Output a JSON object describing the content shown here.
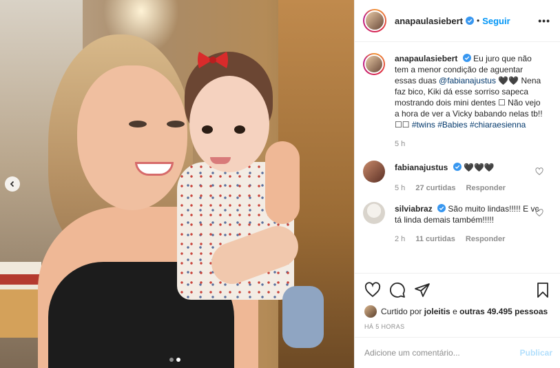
{
  "post": {
    "username": "anapaulasiebert",
    "separator": "•",
    "follow_label": "Seguir",
    "more_icon": "more-options-icon",
    "caption": {
      "username": "anapaulasiebert",
      "text_1": "Eu juro que não tem a menor condição de aguentar essas duas",
      "mention": "@fabianajustus",
      "text_2": "🖤🖤 Nena faz bico, Kiki dá esse sorriso sapeca mostrando dois mini dentes ☐ Não vejo a hora de ver a Vicky babando nelas tb!! ☐☐",
      "hashtag_1": "#twins",
      "hashtag_2": "#Babies",
      "hashtag_3": "#chiaraesienna",
      "time": "5 h"
    },
    "comments": [
      {
        "username": "fabianajustus",
        "text": "🖤🖤🖤",
        "time": "5 h",
        "likes": "27 curtidas",
        "reply": "Responder"
      },
      {
        "username": "silviabraz",
        "text": "São muito lindas!!!!! E vc tá linda demais também!!!!!",
        "time": "2 h",
        "likes": "11 curtidas",
        "reply": "Responder"
      }
    ],
    "liked_by_prefix": "Curtido por",
    "liked_by_user": "joleitis",
    "liked_by_middle": "e",
    "liked_by_others": "outras 49.495 pessoas",
    "post_time": "HÁ 5 HORAS",
    "comment_placeholder": "Adicione um comentário...",
    "publish_label": "Publicar"
  },
  "carousel": {
    "total": 2,
    "active": 2
  },
  "colors": {
    "link": "#0095f6",
    "tag": "#00376b",
    "muted": "#8e8e8e",
    "publish_disabled": "#b2dffc"
  }
}
